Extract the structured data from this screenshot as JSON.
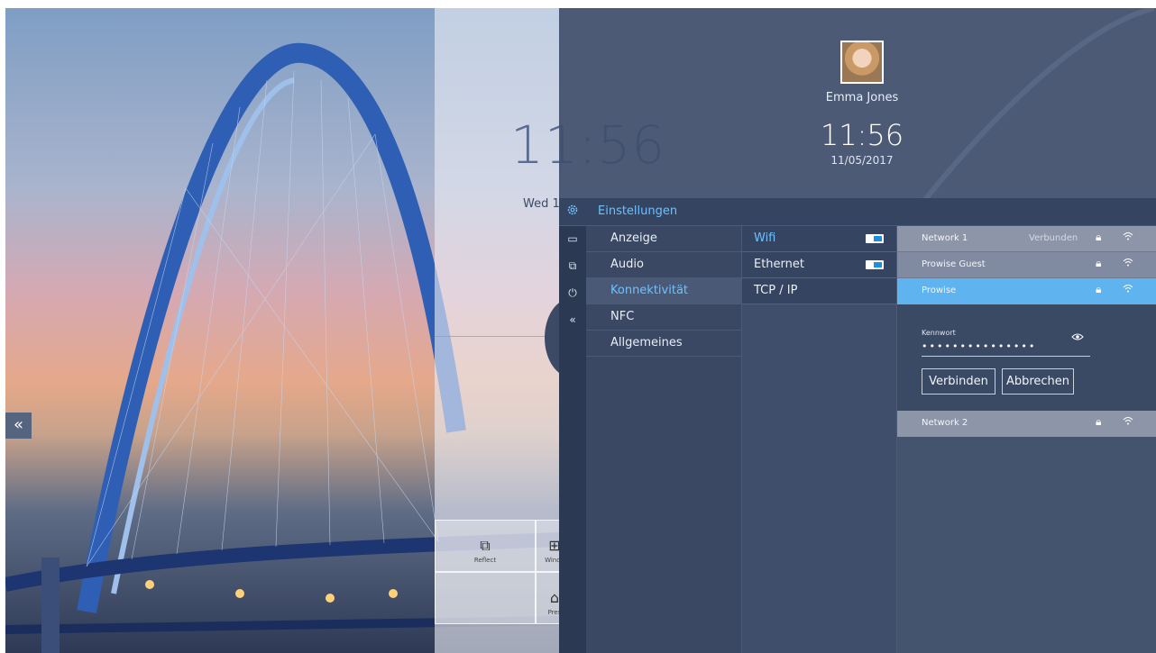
{
  "wallpaper": {
    "clock_time": "11:56",
    "clock_date": "Wed 1",
    "collapse_label": "«",
    "tiles": [
      {
        "label": "Reflect",
        "icon": "screen-mirror-icon"
      },
      {
        "label": "Windo",
        "icon": "window-icon"
      },
      {
        "label": "",
        "icon": ""
      },
      {
        "label": "Pres",
        "icon": "presenter-icon"
      }
    ]
  },
  "header": {
    "user_name": "Emma Jones",
    "time": "11:56",
    "date": "11/05/2017"
  },
  "settings": {
    "title": "Einstellungen",
    "rail": [
      "≡",
      "«"
    ],
    "categories": [
      {
        "label": "Anzeige"
      },
      {
        "label": "Audio"
      },
      {
        "label": "Konnektivität",
        "active": true
      },
      {
        "label": "NFC"
      },
      {
        "label": "Allgemeines"
      }
    ],
    "connection_types": [
      {
        "label": "Wifi",
        "active": true,
        "toggle": "on"
      },
      {
        "label": "Ethernet",
        "toggle": "on"
      },
      {
        "label": "TCP / IP"
      }
    ],
    "networks": [
      {
        "name": "Network 1",
        "status": "Verbunden"
      },
      {
        "name": "Prowise Guest",
        "status": ""
      },
      {
        "name": "Prowise",
        "status": "",
        "selected": true
      },
      {
        "name": "Network 2",
        "status": ""
      }
    ],
    "password": {
      "label": "Kennwort",
      "value": "•••••••••••••••",
      "connect": "Verbinden",
      "cancel": "Abbrechen"
    }
  },
  "colors": {
    "accent": "#6dc1ff",
    "selected_network": "#5fb3ef",
    "panel_bg": "#3a4863"
  }
}
